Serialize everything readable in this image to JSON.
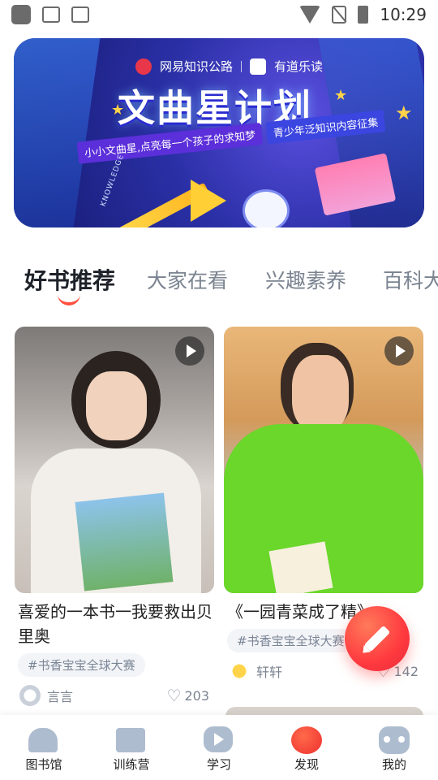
{
  "status_bar": {
    "time": "10:29"
  },
  "banner": {
    "brand_left": "网易知识公路",
    "brand_right": "有道乐读",
    "title": "文曲星计划",
    "slogan_left": "小小文曲星,点亮每一个孩子的求知梦",
    "slogan_right": "青少年泛知识内容征集",
    "decor_text": "KNOWLEDGE",
    "page_count": 3,
    "active_page": 1
  },
  "tabs": [
    {
      "label": "好书推荐",
      "active": true
    },
    {
      "label": "大家在看",
      "active": false
    },
    {
      "label": "兴趣素养",
      "active": false
    },
    {
      "label": "百科大",
      "active": false
    }
  ],
  "feed": [
    {
      "title": "喜爱的一本书一我要救出贝里奥",
      "tag": "#书香宝宝全球大赛",
      "author": "言言",
      "likes": "203",
      "has_video": true
    },
    {
      "title": "《一园青菜成了精》",
      "tag": "#书香宝宝全球大赛",
      "author": "轩轩",
      "likes": "142",
      "has_video": true
    }
  ],
  "bottom_nav": [
    {
      "label": "图书馆",
      "icon": "library-icon",
      "active": false
    },
    {
      "label": "训练营",
      "icon": "book-icon",
      "active": false
    },
    {
      "label": "学习",
      "icon": "play-icon",
      "active": false
    },
    {
      "label": "发现",
      "icon": "planet-icon",
      "active": true
    },
    {
      "label": "我的",
      "icon": "robot-icon",
      "active": false
    }
  ],
  "colors": {
    "accent": "#ff4f3e",
    "tab_inactive": "#7a8390",
    "nav_icon": "#aebccf"
  }
}
